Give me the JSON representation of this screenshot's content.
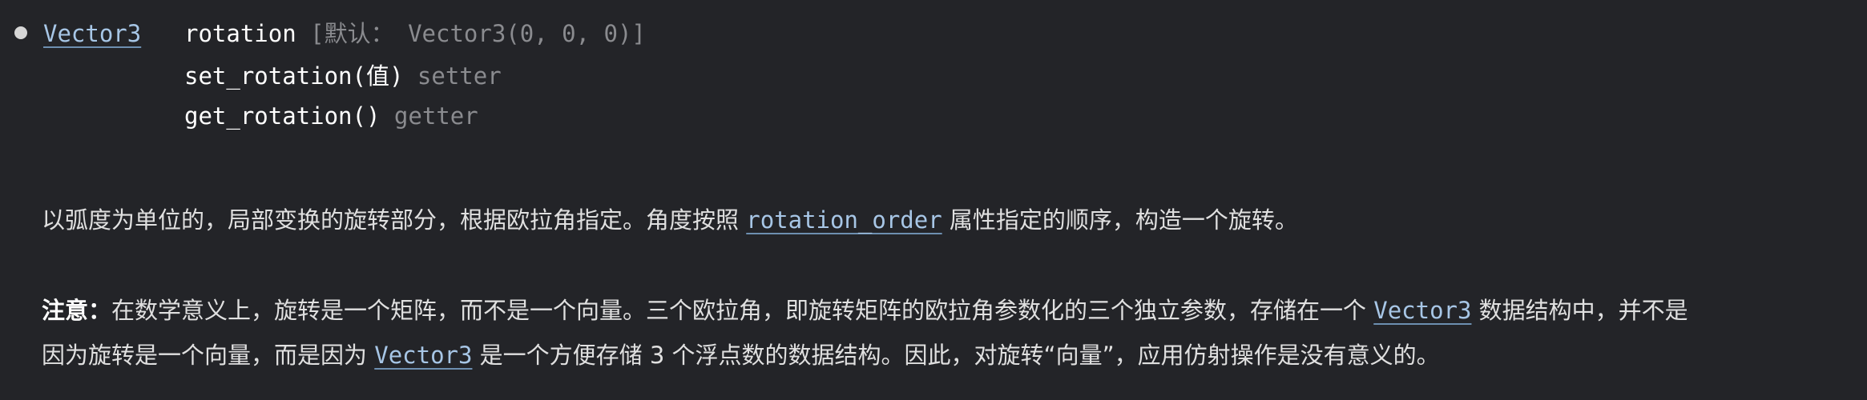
{
  "property": {
    "type_link": "Vector3",
    "name": "rotation",
    "default_text": "[默认： Vector3(0, 0, 0)]",
    "setter_signature": "set_rotation(值)",
    "setter_label": "setter",
    "getter_signature": "get_rotation()",
    "getter_label": "getter"
  },
  "description": {
    "p1_before": "以弧度为单位的，局部变换的旋转部分，根据欧拉角指定。角度按照 ",
    "p1_link": "rotation_order",
    "p1_after": " 属性指定的顺序，构造一个旋转。",
    "note_label": "注意：",
    "p2_line1_before": "在数学意义上，旋转是一个矩阵，而不是一个向量。三个欧拉角，即旋转矩阵的欧拉角参数化的三个独立参数，存储在一个 ",
    "p2_line1_link": "Vector3",
    "p2_line1_after": " 数据结构中，并不是",
    "p2_line2_before": "因为旋转是一个向量，而是因为 ",
    "p2_line2_link": "Vector3",
    "p2_line2_after": " 是一个方便存储 3 个浮点数的数据结构。因此，对旋转“向量”，应用仿射操作是没有意义的。"
  }
}
